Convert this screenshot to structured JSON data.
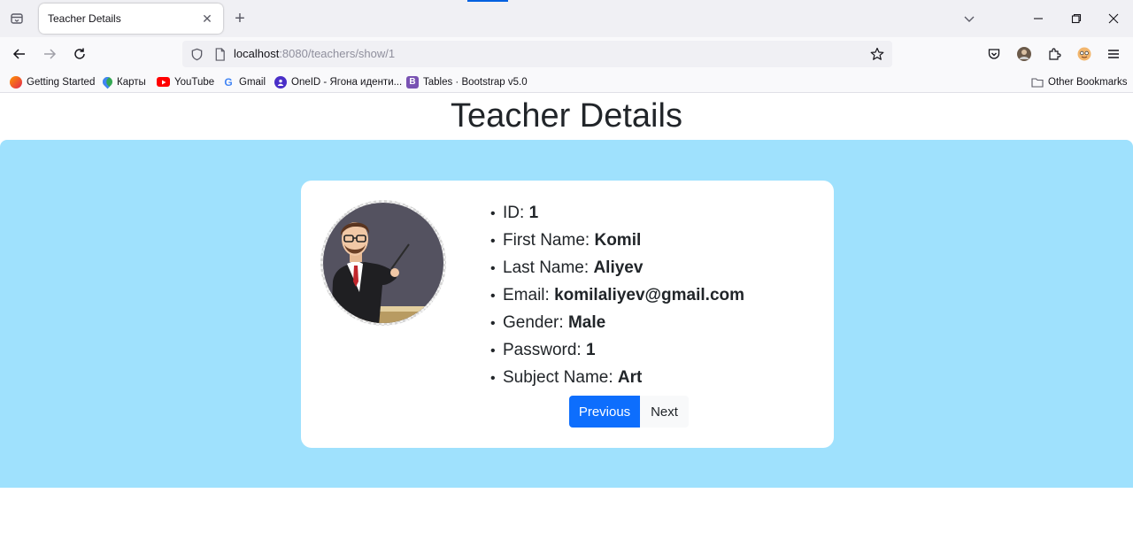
{
  "browser": {
    "tab_title": "Teacher Details",
    "tab_close": "✕",
    "new_tab": "+",
    "url_host": "localhost",
    "url_path": ":8080/teachers/show/1",
    "bookmarks": [
      {
        "label": "Getting Started",
        "icon": "firefox-icon"
      },
      {
        "label": "Карты",
        "icon": "maps-pin-icon"
      },
      {
        "label": "YouTube",
        "icon": "youtube-icon"
      },
      {
        "label": "Gmail",
        "icon": "google-icon"
      },
      {
        "label": "OneID - Ягона идентификатор...",
        "icon": "oneid-icon"
      },
      {
        "label": "Tables · Bootstrap v5.0",
        "icon": "bootstrap-icon"
      }
    ],
    "bookmarks_visible": [
      "Getting Started",
      "Карты",
      "YouTube",
      "Gmail",
      "OneID - Ягона иденти...",
      "Tables · Bootstrap v5.0"
    ],
    "other_bookmarks": "Other Bookmarks"
  },
  "page": {
    "title": "Teacher Details",
    "accent_color": "#0d6efd",
    "hero_color": "#9fe1fd"
  },
  "teacher": {
    "fields": [
      {
        "label": "ID:",
        "value": "1"
      },
      {
        "label": "First Name:",
        "value": "Komil"
      },
      {
        "label": "Last Name:",
        "value": "Aliyev"
      },
      {
        "label": "Email:",
        "value": "komilaliyev@gmail.com"
      },
      {
        "label": "Gender:",
        "value": "Male"
      },
      {
        "label": "Password:",
        "value": "1"
      },
      {
        "label": "Subject Name:",
        "value": "Art"
      }
    ]
  },
  "pagination": {
    "previous": "Previous",
    "next": "Next"
  }
}
